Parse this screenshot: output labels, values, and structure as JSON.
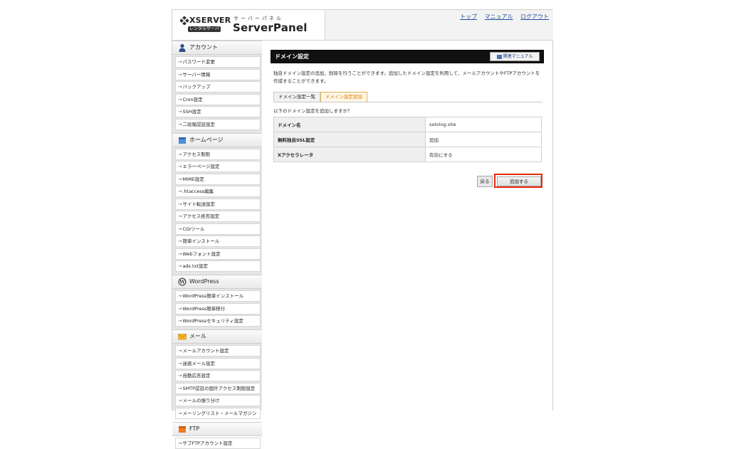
{
  "header": {
    "brand": "XSERVER",
    "badge": "レンタルサーバー",
    "kana": "サーバーパネル",
    "product": "ServerPanel",
    "links": [
      "トップ",
      "マニュアル",
      "ログアウト"
    ]
  },
  "sidebar": {
    "sections": [
      {
        "title": "アカウント",
        "icon": "person-icon",
        "items": [
          "パスワード変更",
          "サーバー情報",
          "バックアップ",
          "Cron設定",
          "SSH設定",
          "二段階認証設定"
        ]
      },
      {
        "title": "ホームページ",
        "icon": "folder-icon",
        "items": [
          "アクセス制限",
          "エラーページ設定",
          "MIME設定",
          ".htaccess編集",
          "サイト転送設定",
          "アクセス拒否設定",
          "CGIツール",
          "簡単インストール",
          "Webフォント設定",
          "ads.txt設定"
        ]
      },
      {
        "title": "WordPress",
        "icon": "wordpress-icon",
        "items": [
          "WordPress簡単インストール",
          "WordPress簡単移行",
          "WordPressセキュリティ設定"
        ]
      },
      {
        "title": "メール",
        "icon": "mail-icon",
        "items": [
          "メールアカウント設定",
          "迷惑メール設定",
          "自動応答設定",
          "SMTP認証の国外アクセス制限設定",
          "メールの振り分け",
          "メーリングリスト・メールマガジン"
        ]
      },
      {
        "title": "FTP",
        "icon": "ftp-icon",
        "items": [
          "サブFTPアカウント設定"
        ]
      }
    ]
  },
  "main": {
    "title": "ドメイン設定",
    "manual_button": "関連マニュアル",
    "description": "独自ドメイン設定の追加、削除を行うことができます。追加したドメイン設定を利用して、メールアカウントやFTPアカウントを作成することができます。",
    "tabs": [
      "ドメイン設定一覧",
      "ドメイン設定追加"
    ],
    "question": "以下のドメイン設定を追加しますか？",
    "rows": [
      {
        "label": "ドメイン名",
        "value": "satolog.site"
      },
      {
        "label": "無料独自SSL設定",
        "value": "追加"
      },
      {
        "label": "Xアクセラレータ",
        "value": "有効にする"
      }
    ],
    "back_button": "戻る",
    "add_button": "追加する"
  },
  "colors": {
    "title_bar": "#111111",
    "highlight": "#e8260f",
    "active_tab": "#e07b00",
    "link": "#1f4e9c"
  }
}
